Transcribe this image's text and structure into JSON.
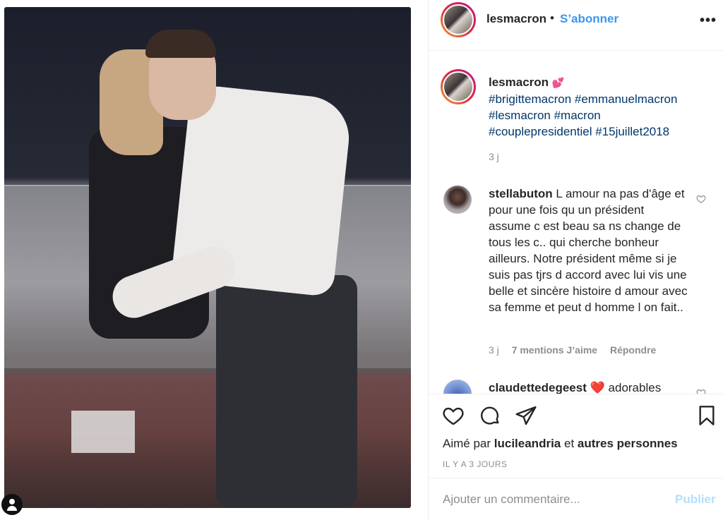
{
  "post": {
    "username": "lesmacron",
    "separator": "•",
    "follow_label": "S’abonner",
    "more_icon": "more-horizontal-icon"
  },
  "caption": {
    "username": "lesmacron",
    "emoji": "💕",
    "hashtags": "#brigittemacron #emmanuelmacron #lesmacron #macron #couplepresidentiel #15juillet2018",
    "time": "3 j"
  },
  "comments": [
    {
      "username": "stellabuton",
      "text": "L amour na pas d'âge et pour une fois qu un président assume c est beau sa ns change de tous les c.. qui cherche bonheur ailleurs. Notre président même si je suis pas tjrs d accord avec lui vis une belle et sincère histoire d amour avec sa femme et peut d homme l on fait..",
      "time": "3 j",
      "likes": "7 mentions J’aime",
      "reply": "Répondre"
    },
    {
      "username": "claudettedegeest",
      "emoji": "❤️",
      "text": "adorables"
    }
  ],
  "actions": {
    "like_icon": "heart-icon",
    "comment_icon": "comment-icon",
    "share_icon": "paper-plane-icon",
    "save_icon": "bookmark-icon"
  },
  "likes": {
    "prefix": "Aimé par",
    "user": "lucileandria",
    "conj": "et",
    "others": "autres personnes"
  },
  "date": "IL Y A 3 JOURS",
  "comment_box": {
    "placeholder": "Ajouter un commentaire...",
    "publish_label": "Publier"
  },
  "colors": {
    "link": "#00376b",
    "follow": "#3897f0",
    "muted": "#8e8e8e",
    "publish_disabled": "#b2dffc"
  }
}
